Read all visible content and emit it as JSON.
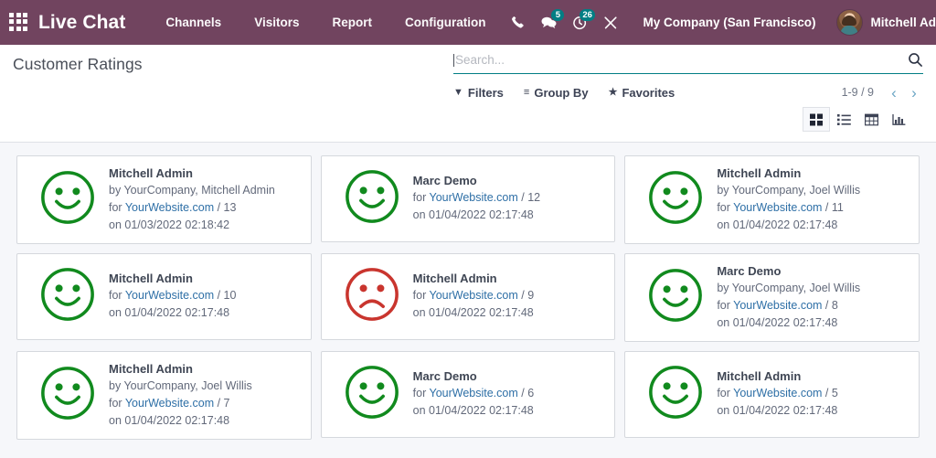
{
  "navbar": {
    "apps_icon": "apps-grid-icon",
    "brand": "Live Chat",
    "menu": [
      {
        "label": "Channels"
      },
      {
        "label": "Visitors"
      },
      {
        "label": "Report"
      },
      {
        "label": "Configuration"
      }
    ],
    "systray": [
      {
        "name": "phone-icon",
        "badge": null
      },
      {
        "name": "messages-icon",
        "badge": "5"
      },
      {
        "name": "activities-clock-icon",
        "badge": "26"
      },
      {
        "name": "tools-wrench-icon",
        "badge": null
      }
    ],
    "company": "My Company (San Francisco)",
    "username": "Mitchell Admin",
    "colors": {
      "background": "#71445f",
      "badge": "#017e84",
      "text": "#ffffff"
    }
  },
  "control_panel": {
    "title": "Customer Ratings",
    "search": {
      "value": "",
      "placeholder": "Search..."
    },
    "buttons": [
      {
        "label": "Filters",
        "icon": "filter-icon",
        "glyph": "▼"
      },
      {
        "label": "Group By",
        "icon": "group-by-icon",
        "glyph": "≡"
      },
      {
        "label": "Favorites",
        "icon": "star-icon",
        "glyph": "★"
      }
    ],
    "pager": {
      "count": "1-9 / 9",
      "prev": "‹",
      "next": "›"
    },
    "views": [
      {
        "name": "kanban-view",
        "active": true
      },
      {
        "name": "list-view",
        "active": false
      },
      {
        "name": "pivot-view",
        "active": false
      },
      {
        "name": "graph-view",
        "active": false
      }
    ]
  },
  "colors": {
    "happy": "#118a1e",
    "sad": "#c9352e",
    "link": "#2e6fa6",
    "page_background": "#f6f7fa",
    "card_background": "#ffffff",
    "card_border": "#d5d8dd"
  },
  "ratings": [
    {
      "rating": "happy",
      "name": "Mitchell Admin",
      "by": "by YourCompany, Mitchell Admin",
      "for_prefix": "for ",
      "for_link": "YourWebsite.com",
      "for_suffix": " / 13",
      "on": "on 01/03/2022 02:18:42"
    },
    {
      "rating": "happy",
      "name": "Marc Demo",
      "by": null,
      "for_prefix": "for ",
      "for_link": "YourWebsite.com",
      "for_suffix": " / 12",
      "on": "on 01/04/2022 02:17:48"
    },
    {
      "rating": "happy",
      "name": "Mitchell Admin",
      "by": "by YourCompany, Joel Willis",
      "for_prefix": "for ",
      "for_link": "YourWebsite.com",
      "for_suffix": " / 11",
      "on": "on 01/04/2022 02:17:48"
    },
    {
      "rating": "happy",
      "name": "Mitchell Admin",
      "by": null,
      "for_prefix": "for ",
      "for_link": "YourWebsite.com",
      "for_suffix": " / 10",
      "on": "on 01/04/2022 02:17:48"
    },
    {
      "rating": "sad",
      "name": "Mitchell Admin",
      "by": null,
      "for_prefix": "for ",
      "for_link": "YourWebsite.com",
      "for_suffix": " / 9",
      "on": "on 01/04/2022 02:17:48"
    },
    {
      "rating": "happy",
      "name": "Marc Demo",
      "by": "by YourCompany, Joel Willis",
      "for_prefix": "for ",
      "for_link": "YourWebsite.com",
      "for_suffix": " / 8",
      "on": "on 01/04/2022 02:17:48"
    },
    {
      "rating": "happy",
      "name": "Mitchell Admin",
      "by": "by YourCompany, Joel Willis",
      "for_prefix": "for ",
      "for_link": "YourWebsite.com",
      "for_suffix": " / 7",
      "on": "on 01/04/2022 02:17:48"
    },
    {
      "rating": "happy",
      "name": "Marc Demo",
      "by": null,
      "for_prefix": "for ",
      "for_link": "YourWebsite.com",
      "for_suffix": " / 6",
      "on": "on 01/04/2022 02:17:48"
    },
    {
      "rating": "happy",
      "name": "Mitchell Admin",
      "by": null,
      "for_prefix": "for ",
      "for_link": "YourWebsite.com",
      "for_suffix": " / 5",
      "on": "on 01/04/2022 02:17:48"
    }
  ]
}
